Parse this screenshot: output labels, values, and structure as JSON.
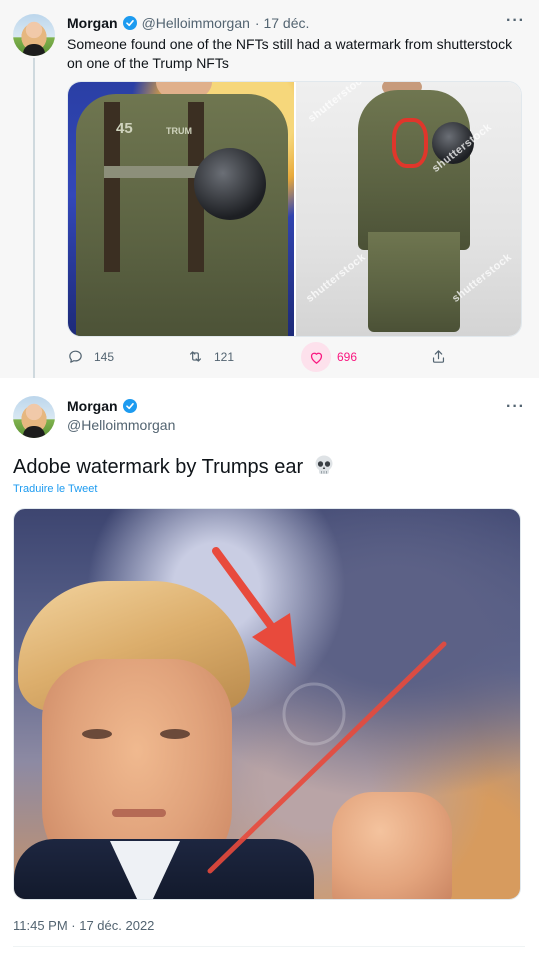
{
  "parent_tweet": {
    "author_name": "Morgan",
    "handle": "@Helloimmorgan",
    "date": "· 17 déc.",
    "more": "···",
    "text": "Someone found one of the NFTs still had a watermark from shutterstock on one of the Trump NFTs",
    "image_left_text": "TRUM",
    "image_left_patch": "45",
    "watermark": "shutterstock",
    "actions": {
      "reply_count": "145",
      "retweet_count": "121",
      "like_count": "696"
    }
  },
  "main_tweet": {
    "author_name": "Morgan",
    "handle": "@Helloimmorgan",
    "more": "···",
    "text": "Adobe watermark by Trumps ear",
    "translate": "Traduire le Tweet",
    "timestamp": "11:45 PM · 17 déc. 2022"
  },
  "colors": {
    "accent": "#1d9bf0",
    "like": "#f91880",
    "annotation_red": "#e84a3c",
    "muted_text": "#536471"
  },
  "icons": [
    "verified-badge-icon",
    "more-icon",
    "reply-icon",
    "retweet-icon",
    "heart-icon",
    "share-icon",
    "skull-emoji-icon"
  ]
}
